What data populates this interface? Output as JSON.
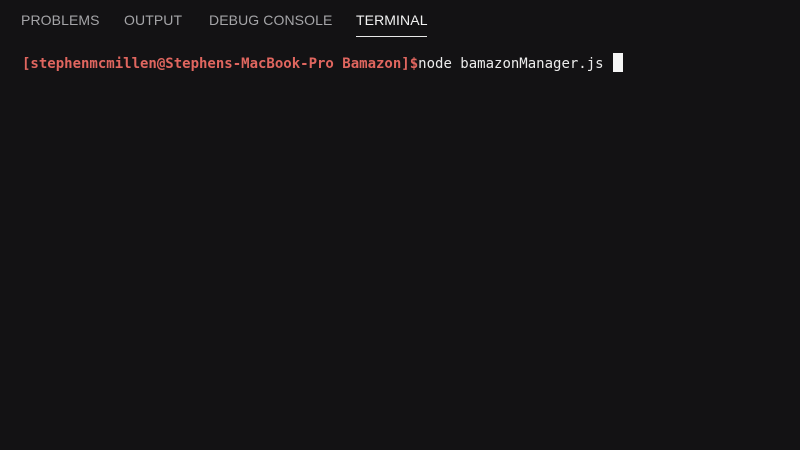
{
  "tabs": [
    {
      "label": "PROBLEMS",
      "active": false
    },
    {
      "label": "OUTPUT",
      "active": false
    },
    {
      "label": "DEBUG CONSOLE",
      "active": false
    },
    {
      "label": "TERMINAL",
      "active": true
    }
  ],
  "terminal": {
    "prompt": "[stephenmcmillen@Stephens-MacBook-Pro Bamazon]$",
    "command": "node bamazonManager.js"
  },
  "colors": {
    "background": "#131214",
    "prompt": "#e0665f",
    "command": "#ececec",
    "tab_inactive": "#a5a5a8",
    "tab_active": "#f2f2f2"
  }
}
